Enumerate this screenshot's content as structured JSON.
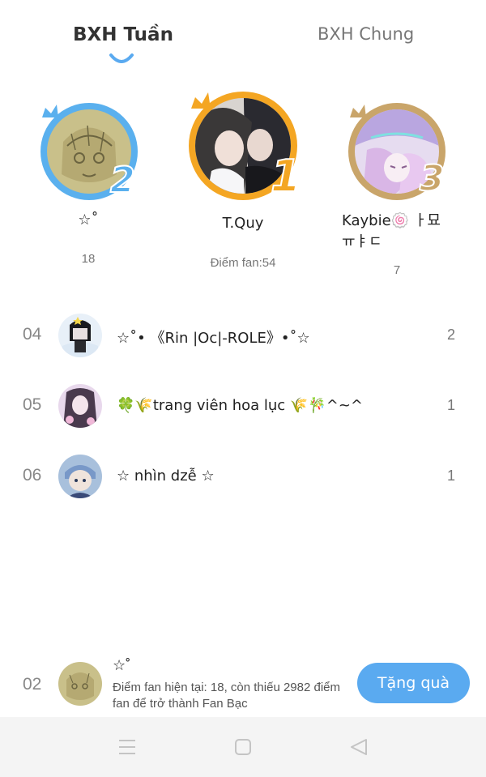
{
  "tabs": [
    {
      "label": "BXH Tuần",
      "active": true
    },
    {
      "label": "BXH Chung",
      "active": false
    }
  ],
  "podium": [
    {
      "rank": "2",
      "name": "☆˚",
      "score": "18"
    },
    {
      "rank": "1",
      "name": "T.Quy",
      "score": "Điểm fan:54"
    },
    {
      "rank": "3",
      "name": "Kaybie🍥 ㅏ묘ㅠㅑㄷ",
      "score": "7"
    }
  ],
  "list": [
    {
      "rank": "04",
      "name": "☆˚• 《Rin |Oc|-ROLE》•˚☆",
      "score": "2"
    },
    {
      "rank": "05",
      "name": "🍀🌾trang viên hoa lục 🌾🎋^~^",
      "score": "1"
    },
    {
      "rank": "06",
      "name": "☆ nhìn dzễ ☆",
      "score": "1"
    }
  ],
  "me": {
    "rank": "02",
    "name": "☆˚",
    "description": "Điểm fan hiện tại: 18, còn thiếu 2982 điểm fan để trở thành Fan Bạc",
    "button": "Tặng quà"
  },
  "colors": {
    "accent": "#5aaaf0",
    "gold": "#f4a623",
    "silver_blue": "#5ab0ee",
    "bronze": "#c9a56a"
  },
  "icons": {
    "nav_menu": "menu-icon",
    "nav_home": "home-icon",
    "nav_back": "back-icon"
  }
}
